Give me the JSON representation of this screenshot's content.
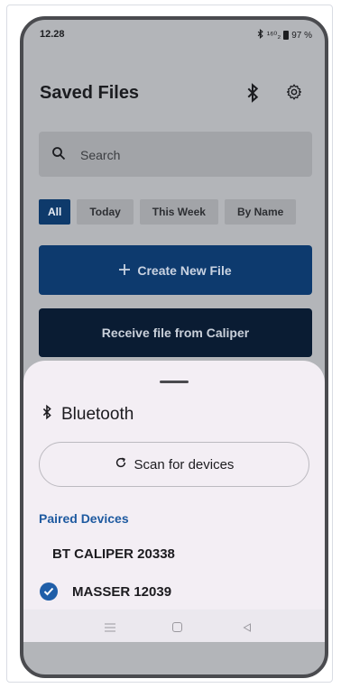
{
  "status_bar": {
    "time": "12.28",
    "signal_text": "¹⁶⁰₂",
    "battery": "97 %"
  },
  "header": {
    "title": "Saved Files"
  },
  "search": {
    "placeholder": "Search"
  },
  "filters": [
    "All",
    "Today",
    "This Week",
    "By Name"
  ],
  "actions": {
    "create": "Create New File",
    "receive": "Receive file from Caliper"
  },
  "sheet": {
    "title": "Bluetooth",
    "scan_label": "Scan for devices",
    "section": "Paired Devices",
    "devices": [
      "BT CALIPER 20338",
      "MASSER 12039"
    ]
  },
  "colors": {
    "primary": "#0d3a6e",
    "accent": "#1f5ea8",
    "sheet_bg": "#f3eef4"
  }
}
